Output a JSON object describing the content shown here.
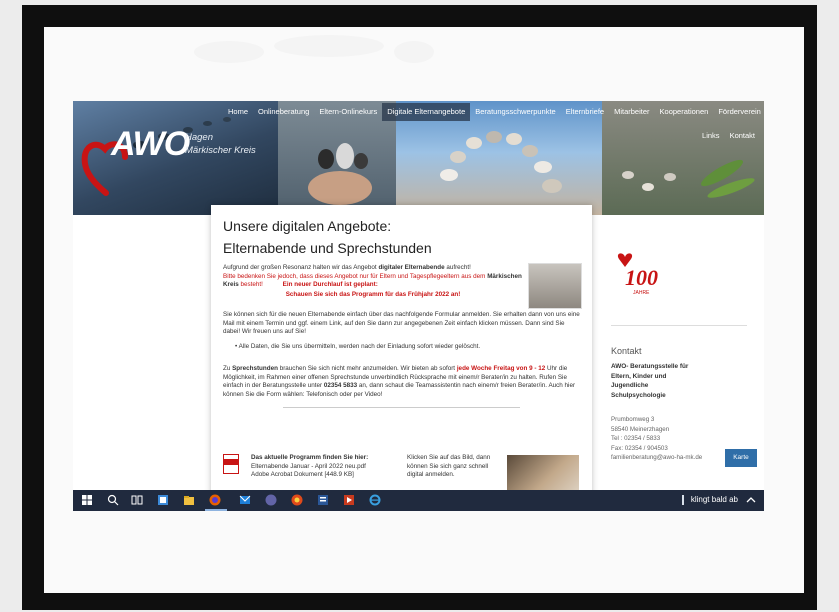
{
  "nav": {
    "items": [
      "Home",
      "Onlineberatung",
      "Eltern-Onlinekurs",
      "Digitale Elternangebote",
      "Beratungsschwerpunkte",
      "Elternbriefe",
      "Mitarbeiter",
      "Kooperationen",
      "Förderverein"
    ],
    "active": "Digitale Elternangebote",
    "secondary": [
      "Links",
      "Kontakt"
    ]
  },
  "logo": {
    "brand": "AWO",
    "line1": "Hagen",
    "line2": "Märkischer Kreis"
  },
  "content": {
    "title1": "Unsere digitalen Angebote:",
    "title2": "Elternabende und Sprechstunden",
    "intro_a": "Aufgrund der großen Resonanz halten wir das Angebot ",
    "intro_b": "digitaler Elternabende",
    "intro_c": " aufrecht!",
    "notice_a": "Bitte bedenken Sie jedoch, dass dieses Angebot nur für Eltern und Tagespflegeeltern aus dem ",
    "notice_b": "Märkischen Kreis",
    "notice_c": " besteht!",
    "durchlauf": "Ein neuer Durchlauf ist geplant:",
    "programm": "Schauen Sie sich das Programm für das Frühjahr 2022 an!",
    "para2": "Sie können sich für die neuen Elternabende einfach über das nachfolgende Formular anmelden. Sie erhalten dann von uns eine Mail mit einem Termin und ggf. einem Link, auf den Sie dann zur angegebenen Zeit einfach klicken müssen. Dann sind Sie dabei! Wir freuen uns auf Sie!",
    "bullet": "Alle Daten, die Sie uns übermitteln, werden nach der Einladung sofort wieder gelöscht.",
    "p3_a": "Zu ",
    "p3_b": "Sprechstunden",
    "p3_c": " brauchen Sie sich nicht mehr anzumelden. Wir bieten ab sofort ",
    "p3_d": "jede Woche Freitag von 9 - 12",
    "p3_e": " Uhr die Möglichkeit, im Rahmen einer offenen Sprechstunde unverbindlich Rücksprache mit einem/r Berater/in zu halten. Rufen Sie einfach in der Beratungsstelle unter ",
    "p3_f": "02354 5833",
    "p3_g": " an, dann schaut die Teamassistentin nach einem/r freien Berater/in. Auch hier können Sie die Form wählen: Telefonisch oder per Video!",
    "download_title": "Das aktuelle Programm finden Sie hier:",
    "download_name": "Elternabende Januar - April 2022 neu.pdf",
    "download_type": "Adobe Acrobat Dokument [448.9 KB]",
    "click_text": "Klicken Sie auf das Bild, dann können Sie sich ganz schnell digital anmelden."
  },
  "sidebar": {
    "badge_number": "100",
    "badge_sub": "JAHRE",
    "title": "Kontakt",
    "org": [
      "AWO- Beratungsstelle für",
      "Eltern, Kinder und",
      "Jugendliche",
      "Schulpsychologie"
    ],
    "addr": [
      "Prumbomweg 3",
      "58540 Meinerzhagen",
      "Tel : 02354 / 5833",
      "Fax: 02354 / 904503",
      "familienberatung@awo-ha-mk.de"
    ],
    "map_button": "Karte"
  },
  "taskbar": {
    "status": "klingt bald ab"
  },
  "colors": {
    "awo_red": "#c81414",
    "nav_active": "#2b3a50",
    "taskbar": "#202a3e",
    "button_blue": "#2f6ea8"
  }
}
